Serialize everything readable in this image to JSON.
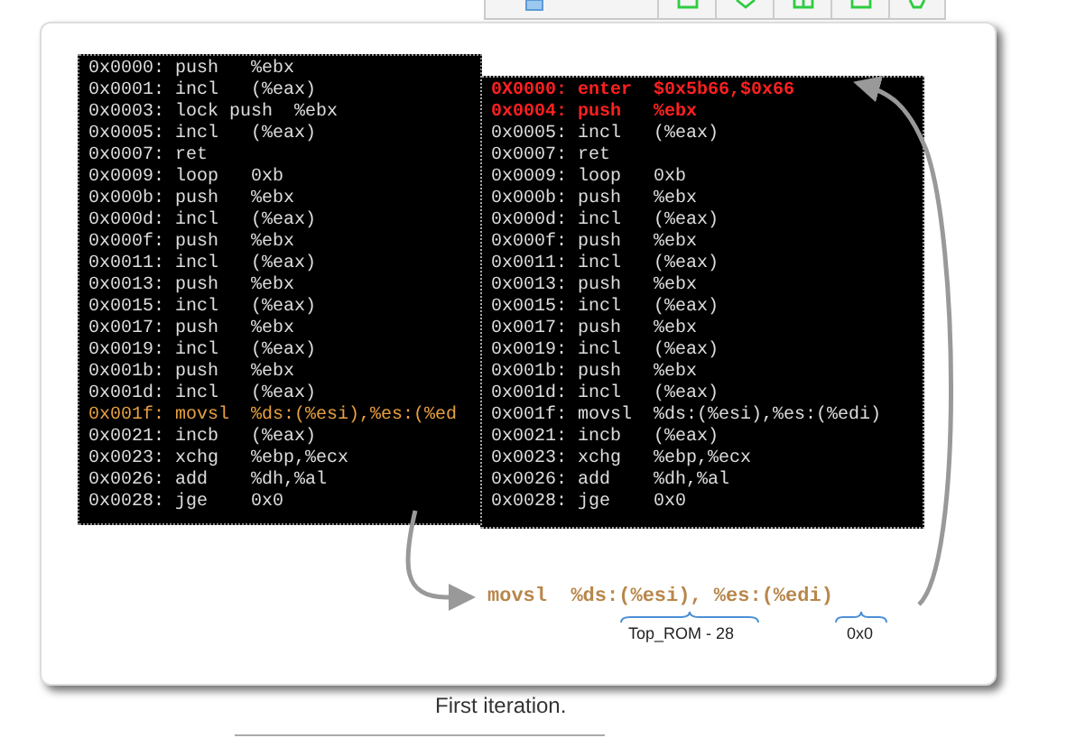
{
  "listing_left": [
    {
      "text": "0x0000: push   %ebx",
      "kind": "normal"
    },
    {
      "text": "0x0001: incl   (%eax)",
      "kind": "normal"
    },
    {
      "text": "0x0003: lock push  %ebx",
      "kind": "normal"
    },
    {
      "text": "0x0005: incl   (%eax)",
      "kind": "normal"
    },
    {
      "text": "0x0007: ret",
      "kind": "normal"
    },
    {
      "text": "0x0009: loop   0xb",
      "kind": "normal"
    },
    {
      "text": "0x000b: push   %ebx",
      "kind": "normal"
    },
    {
      "text": "0x000d: incl   (%eax)",
      "kind": "normal"
    },
    {
      "text": "0x000f: push   %ebx",
      "kind": "normal"
    },
    {
      "text": "0x0011: incl   (%eax)",
      "kind": "normal"
    },
    {
      "text": "0x0013: push   %ebx",
      "kind": "normal"
    },
    {
      "text": "0x0015: incl   (%eax)",
      "kind": "normal"
    },
    {
      "text": "0x0017: push   %ebx",
      "kind": "normal"
    },
    {
      "text": "0x0019: incl   (%eax)",
      "kind": "normal"
    },
    {
      "text": "0x001b: push   %ebx",
      "kind": "normal"
    },
    {
      "text": "0x001d: incl   (%eax)",
      "kind": "normal"
    },
    {
      "text": "0x001f: movsl  %ds:(%esi),%es:(%ed",
      "kind": "highlight"
    },
    {
      "text": "0x0021: incb   (%eax)",
      "kind": "normal"
    },
    {
      "text": "0x0023: xchg   %ebp,%ecx",
      "kind": "normal"
    },
    {
      "text": "0x0026: add    %dh,%al",
      "kind": "normal"
    },
    {
      "text": "0x0028: jge    0x0",
      "kind": "normal"
    }
  ],
  "listing_right": [
    {
      "text": "0X0000: enter  $0x5b66,$0x66",
      "kind": "changed"
    },
    {
      "text": "0x0004: push   %ebx",
      "kind": "changed"
    },
    {
      "text": "0x0005: incl   (%eax)",
      "kind": "normal"
    },
    {
      "text": "0x0007: ret",
      "kind": "normal"
    },
    {
      "text": "0x0009: loop   0xb",
      "kind": "normal"
    },
    {
      "text": "0x000b: push   %ebx",
      "kind": "normal"
    },
    {
      "text": "0x000d: incl   (%eax)",
      "kind": "normal"
    },
    {
      "text": "0x000f: push   %ebx",
      "kind": "normal"
    },
    {
      "text": "0x0011: incl   (%eax)",
      "kind": "normal"
    },
    {
      "text": "0x0013: push   %ebx",
      "kind": "normal"
    },
    {
      "text": "0x0015: incl   (%eax)",
      "kind": "normal"
    },
    {
      "text": "0x0017: push   %ebx",
      "kind": "normal"
    },
    {
      "text": "0x0019: incl   (%eax)",
      "kind": "normal"
    },
    {
      "text": "0x001b: push   %ebx",
      "kind": "normal"
    },
    {
      "text": "0x001d: incl   (%eax)",
      "kind": "normal"
    },
    {
      "text": "0x001f: movsl  %ds:(%esi),%es:(%edi)",
      "kind": "normal"
    },
    {
      "text": "0x0021: incb   (%eax)",
      "kind": "normal"
    },
    {
      "text": "0x0023: xchg   %ebp,%ecx",
      "kind": "normal"
    },
    {
      "text": "0x0026: add    %dh,%al",
      "kind": "normal"
    },
    {
      "text": "0x0028: jge    0x0",
      "kind": "normal"
    }
  ],
  "annotation": {
    "instruction": "movsl  %ds:(%esi), %es:(%edi)",
    "source_label": "Top_ROM - 28",
    "dest_label": "0x0"
  },
  "caption": "First iteration."
}
